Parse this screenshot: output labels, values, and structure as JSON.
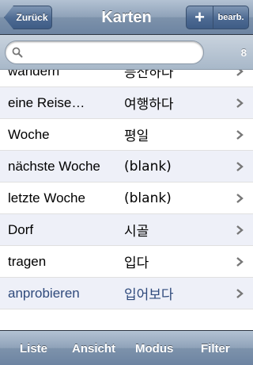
{
  "navbar": {
    "back_label": "Zurück",
    "title": "Karten",
    "add_label": "+",
    "edit_label": "bearb."
  },
  "search": {
    "placeholder": "",
    "value": "",
    "count": "8"
  },
  "list": {
    "rows": [
      {
        "german": "wandern",
        "korean": "등산하다"
      },
      {
        "german": "eine Reise…",
        "korean": "여행하다"
      },
      {
        "german": "Woche",
        "korean": "평일"
      },
      {
        "german": "nächste Woche",
        "korean": "(blank)"
      },
      {
        "german": "letzte Woche",
        "korean": "(blank)"
      },
      {
        "german": "Dorf",
        "korean": "시골"
      },
      {
        "german": "tragen",
        "korean": "입다"
      },
      {
        "german": "anprobieren",
        "korean": "입어보다"
      }
    ]
  },
  "toolbar": {
    "items": [
      "Liste",
      "Ansicht",
      "Modus",
      "Filter"
    ]
  },
  "colors": {
    "selected_text": "#2f4a7c",
    "alt_row": "#eef0f8",
    "bar_dark": "#6d84a2"
  }
}
